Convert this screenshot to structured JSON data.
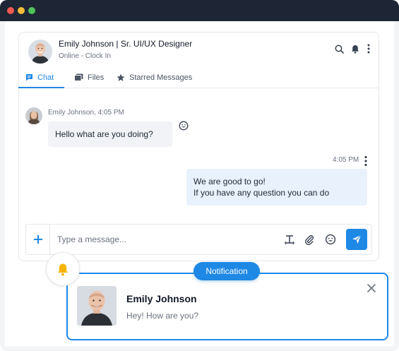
{
  "window": {
    "controls": [
      "close",
      "minimize",
      "maximize"
    ],
    "colors": {
      "titlebar": "#1e2535",
      "accent": "#1e88e5"
    }
  },
  "chat_header": {
    "title": "Emily Johnson | Sr. UI/UX Designer",
    "status": "Online -",
    "status_action": "Clock In",
    "icons": [
      "search-icon",
      "bell-icon",
      "more-vertical-icon"
    ]
  },
  "tabs": [
    {
      "label": "Chat",
      "icon": "chat-icon",
      "active": true
    },
    {
      "label": "Files",
      "icon": "files-icon",
      "active": false
    },
    {
      "label": "Starred Messages",
      "icon": "star-icon",
      "active": false
    }
  ],
  "messages": [
    {
      "sender": "Emily Johnson, 4:05 PM",
      "text": "Hello what are you doing?",
      "direction": "incoming"
    },
    {
      "time": "4:05 PM",
      "lines": [
        "We are good to go!",
        "If you have any question you can do"
      ],
      "direction": "outgoing"
    }
  ],
  "composer": {
    "placeholder": "Type a message...",
    "icons": [
      "plus-icon",
      "text-format-icon",
      "attach-icon",
      "emoji-icon",
      "send-icon"
    ]
  },
  "notification": {
    "badge": "Notification",
    "name": "Emily Johnson",
    "message": "Hey! How are you?"
  }
}
